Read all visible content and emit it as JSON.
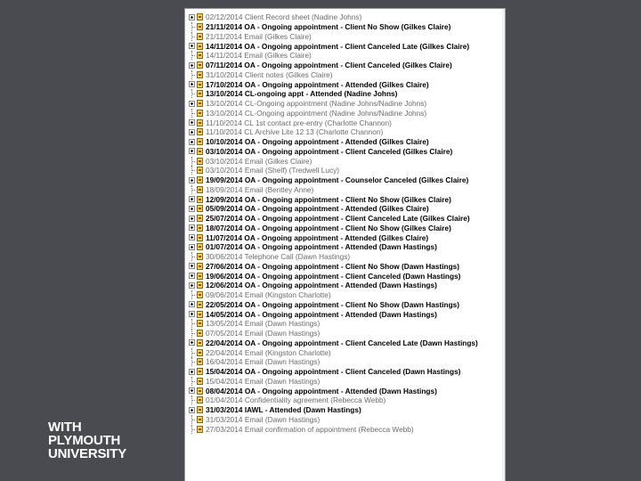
{
  "tree": {
    "items": [
      {
        "label": "02/12/2014 Client Record sheet (Nadine Johns)",
        "style": "faded",
        "node": "expander"
      },
      {
        "label": "21/11/2014 OA - Ongoing appointment - Client No Show (Gilkes Claire)",
        "style": "bold",
        "node": "leaf"
      },
      {
        "label": "21/11/2014 Email (Gilkes Claire)",
        "style": "faded",
        "node": "leaf"
      },
      {
        "label": "14/11/2014 OA - Ongoing appointment - Client Canceled Late (Gilkes Claire)",
        "style": "bold",
        "node": "expander"
      },
      {
        "label": "14/11/2014 Email (Gilkes Claire)",
        "style": "faded",
        "node": "leaf"
      },
      {
        "label": "07/11/2014 OA - Ongoing appointment - Client Canceled (Gilkes Claire)",
        "style": "bold",
        "node": "expander"
      },
      {
        "label": "31/10/2014 Client notes (Gilkes Claire)",
        "style": "faded",
        "node": "leaf"
      },
      {
        "label": "17/10/2014 OA - Ongoing appointment - Attended (Gilkes Claire)",
        "style": "bold",
        "node": "expander"
      },
      {
        "label": "13/10/2014 CL-ongoing appt - Attended (Nadine Johns)",
        "style": "bold",
        "node": "leaf"
      },
      {
        "label": "13/10/2014 CL-Ongoing appointment (Nadine Johns/Nadine Johns)",
        "style": "faded",
        "node": "expander"
      },
      {
        "label": "13/10/2014 CL-Ongoing appointment (Nadine Johns/Nadine Johns)",
        "style": "faded",
        "node": "leaf"
      },
      {
        "label": "11/10/2014 CL 1st contact pre-entry (Charlotte Channon)",
        "style": "faded",
        "node": "expander"
      },
      {
        "label": "11/10/2014 CL Archive Lite 12 13 (Charlotte Channon)",
        "style": "faded",
        "node": "expander"
      },
      {
        "label": "10/10/2014 OA - Ongoing appointment - Attended (Gilkes Claire)",
        "style": "bold",
        "node": "expander"
      },
      {
        "label": "03/10/2014 OA - Ongoing appointment - Client Canceled (Gilkes Claire)",
        "style": "bold",
        "node": "expander"
      },
      {
        "label": "03/10/2014 Email (Gilkes Claire)",
        "style": "faded",
        "node": "leaf"
      },
      {
        "label": "03/10/2014 Email (Shelf) (Tredwell Lucy)",
        "style": "faded",
        "node": "leaf"
      },
      {
        "label": "19/09/2014 OA - Ongoing appointment - Counselor Canceled (Gilkes Claire)",
        "style": "bold",
        "node": "expander"
      },
      {
        "label": "18/09/2014 Email (Bentley Anne)",
        "style": "faded",
        "node": "leaf"
      },
      {
        "label": "12/09/2014 OA - Ongoing appointment - Client No Show (Gilkes Claire)",
        "style": "bold",
        "node": "expander"
      },
      {
        "label": "05/09/2014 OA - Ongoing appointment - Attended (Gilkes Claire)",
        "style": "bold",
        "node": "expander"
      },
      {
        "label": "25/07/2014 OA - Ongoing appointment - Client Canceled Late (Gilkes Claire)",
        "style": "bold",
        "node": "expander"
      },
      {
        "label": "18/07/2014 OA - Ongoing appointment - Client No Show (Gilkes Claire)",
        "style": "bold",
        "node": "expander"
      },
      {
        "label": "11/07/2014 OA - Ongoing appointment - Attended (Gilkes Claire)",
        "style": "bold",
        "node": "expander"
      },
      {
        "label": "01/07/2014 OA - Ongoing appointment - Attended (Dawn Hastings)",
        "style": "bold",
        "node": "expander"
      },
      {
        "label": "30/06/2014 Telephone Call (Dawn Hastings)",
        "style": "faded",
        "node": "leaf"
      },
      {
        "label": "27/06/2014 OA - Ongoing appointment - Client No Show (Dawn Hastings)",
        "style": "bold",
        "node": "expander"
      },
      {
        "label": "19/06/2014 OA - Ongoing appointment - Client Canceled (Dawn Hastings)",
        "style": "bold",
        "node": "expander"
      },
      {
        "label": "12/06/2014 OA - Ongoing appointment - Attended (Dawn Hastings)",
        "style": "bold",
        "node": "expander"
      },
      {
        "label": "09/06/2014 Email (Kingston Charlotte)",
        "style": "faded",
        "node": "leaf"
      },
      {
        "label": "22/05/2014 OA - Ongoing appointment - Client No Show (Dawn Hastings)",
        "style": "bold",
        "node": "expander"
      },
      {
        "label": "14/05/2014 OA - Ongoing appointment - Attended (Dawn Hastings)",
        "style": "bold",
        "node": "expander"
      },
      {
        "label": "13/05/2014 Email (Dawn Hastings)",
        "style": "faded",
        "node": "leaf"
      },
      {
        "label": "07/05/2014 Email (Dawn Hastings)",
        "style": "faded",
        "node": "leaf"
      },
      {
        "label": "22/04/2014 OA - Ongoing appointment - Client Canceled Late (Dawn Hastings)",
        "style": "bold",
        "node": "expander"
      },
      {
        "label": "22/04/2014 Email (Kingston Charlotte)",
        "style": "faded",
        "node": "leaf"
      },
      {
        "label": "16/04/2014 Email (Dawn Hastings)",
        "style": "faded",
        "node": "leaf"
      },
      {
        "label": "15/04/2014 OA - Ongoing appointment - Client Canceled (Dawn Hastings)",
        "style": "bold",
        "node": "expander"
      },
      {
        "label": "15/04/2014 Email (Dawn Hastings)",
        "style": "faded",
        "node": "leaf"
      },
      {
        "label": "08/04/2014 OA - Ongoing appointment - Attended (Dawn Hastings)",
        "style": "bold",
        "node": "expander"
      },
      {
        "label": "01/04/2014 Confidentiality agreement (Rebecca Webb)",
        "style": "faded",
        "node": "leaf"
      },
      {
        "label": "31/03/2014 IAWL - Attended (Dawn Hastings)",
        "style": "bold",
        "node": "expander"
      },
      {
        "label": "31/03/2014 Email (Dawn Hastings)",
        "style": "faded",
        "node": "leaf"
      },
      {
        "label": "27/03/2014 Email confirmation of appointment (Rebecca Webb)",
        "style": "faded",
        "node": "leaf"
      }
    ]
  },
  "brand": {
    "line1": "WITH",
    "line2": "PLYMOUTH",
    "line3": "UNIVERSITY"
  },
  "colors": {
    "background": "#4a4b50",
    "panel": "#ffffff",
    "icon": "#f3d64a"
  }
}
